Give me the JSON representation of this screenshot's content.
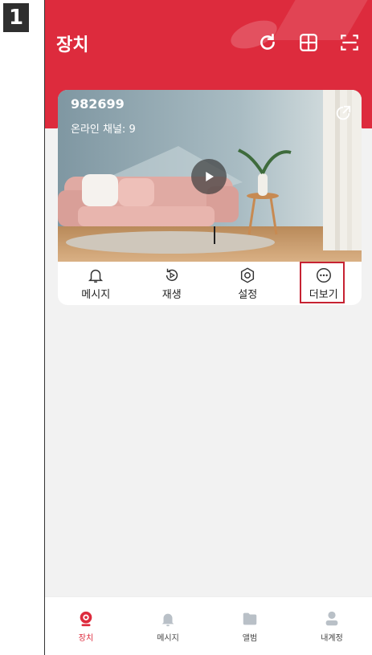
{
  "step_badge": "1",
  "header": {
    "title": "장치"
  },
  "device": {
    "name": "982699",
    "channels": "온라인 채널: 9"
  },
  "actions": [
    {
      "label": "메시지",
      "icon": "bell-icon"
    },
    {
      "label": "재생",
      "icon": "replay-icon"
    },
    {
      "label": "설정",
      "icon": "settings-icon"
    },
    {
      "label": "더보기",
      "icon": "more-icon"
    }
  ],
  "tabs": [
    {
      "label": "장치",
      "icon": "camera-icon",
      "active": true
    },
    {
      "label": "메시지",
      "icon": "bell-icon"
    },
    {
      "label": "앨범",
      "icon": "folder-icon"
    },
    {
      "label": "내계정",
      "icon": "user-icon"
    }
  ],
  "colors": {
    "accent": "#dd2b3d",
    "highlight": "#c62232"
  }
}
